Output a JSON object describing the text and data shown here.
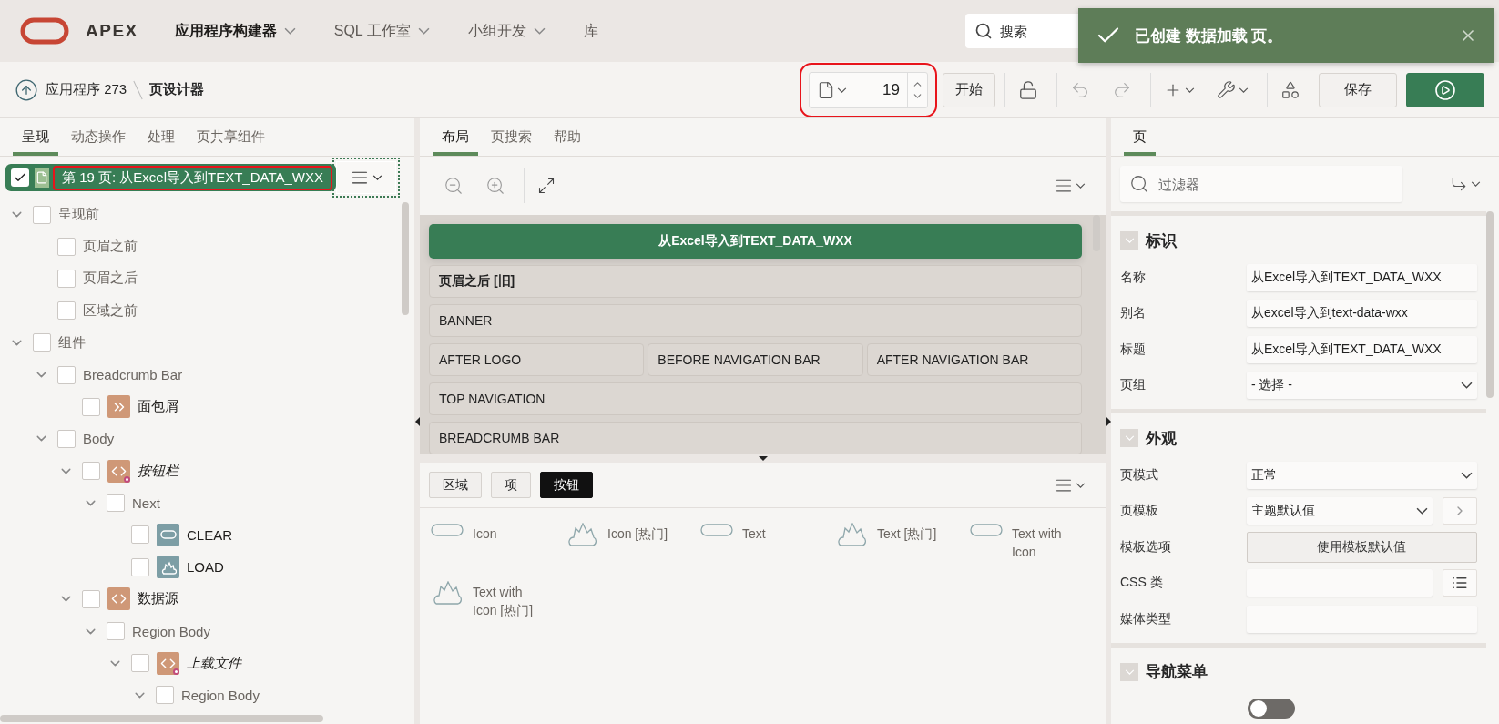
{
  "header": {
    "logo": "APEX",
    "nav": [
      {
        "label": "应用程序构建器",
        "selected": true,
        "has_menu": true
      },
      {
        "label": "SQL 工作室",
        "selected": false,
        "has_menu": true
      },
      {
        "label": "小组开发",
        "selected": false,
        "has_menu": true
      },
      {
        "label": "库",
        "selected": false,
        "has_menu": false
      }
    ],
    "search": {
      "placeholder": "搜索"
    },
    "toast": {
      "message": "已创建 数据加载 页。"
    }
  },
  "breadcrumb": {
    "parent": "应用程序 273",
    "current": "页设计器"
  },
  "toolbar": {
    "page_number": "19",
    "start_button": "开始",
    "save_button": "保存"
  },
  "left": {
    "tabs": [
      {
        "label": "呈现",
        "selected": true
      },
      {
        "label": "动态操作",
        "selected": false
      },
      {
        "label": "处理",
        "selected": false
      },
      {
        "label": "页共享组件",
        "selected": false
      }
    ],
    "tree": {
      "label": "第 19 页: 从Excel导入到TEXT_DATA_WXX",
      "checked": true,
      "children": [
        {
          "label": "呈现前",
          "kind": "group",
          "checked": false,
          "expanded": true,
          "children": [
            {
              "label": "页眉之前",
              "kind": "group",
              "checked": false
            },
            {
              "label": "页眉之后",
              "kind": "group",
              "checked": false
            },
            {
              "label": "区域之前",
              "kind": "group",
              "checked": false
            }
          ]
        },
        {
          "label": "组件",
          "kind": "group",
          "checked": false,
          "expanded": true,
          "children": [
            {
              "label": "Breadcrumb Bar",
              "kind": "group",
              "checked": false,
              "expanded": true,
              "children": [
                {
                  "label": "面包屑",
                  "kind": "breadcrumb",
                  "checked": false
                }
              ]
            },
            {
              "label": "Body",
              "kind": "group",
              "checked": false,
              "expanded": true,
              "children": [
                {
                  "label": "按钮栏",
                  "kind": "region",
                  "conditional": true,
                  "checked": false,
                  "expanded": true,
                  "children": [
                    {
                      "label": "Next",
                      "kind": "group",
                      "checked": false,
                      "expanded": true,
                      "children": [
                        {
                          "label": "CLEAR",
                          "kind": "button",
                          "checked": false
                        },
                        {
                          "label": "LOAD",
                          "kind": "hot-button",
                          "checked": false
                        }
                      ]
                    }
                  ]
                },
                {
                  "label": "数据源",
                  "kind": "region",
                  "conditional": false,
                  "checked": false,
                  "expanded": true,
                  "children": [
                    {
                      "label": "Region Body",
                      "kind": "group",
                      "checked": false,
                      "expanded": true,
                      "children": [
                        {
                          "label": "上载文件",
                          "kind": "region",
                          "conditional": true,
                          "checked": false,
                          "expanded": true,
                          "children": [
                            {
                              "label": "Region Body",
                              "kind": "group",
                              "checked": false,
                              "expanded": true
                            }
                          ]
                        }
                      ]
                    }
                  ]
                }
              ]
            }
          ]
        }
      ]
    }
  },
  "middle": {
    "tabs": [
      {
        "label": "布局",
        "selected": true
      },
      {
        "label": "页搜索",
        "selected": false
      },
      {
        "label": "帮助",
        "selected": false
      }
    ],
    "page_title": "从Excel导入到TEXT_DATA_WXX",
    "slot_rows": [
      [
        {
          "label": "页眉之后 [旧]",
          "kind": "legacy"
        }
      ],
      [
        {
          "label": "BANNER",
          "kind": "position"
        }
      ],
      [
        {
          "label": "AFTER LOGO",
          "kind": "position"
        },
        {
          "label": "BEFORE NAVIGATION BAR",
          "kind": "position"
        },
        {
          "label": "AFTER NAVIGATION BAR",
          "kind": "position"
        }
      ],
      [
        {
          "label": "TOP NAVIGATION",
          "kind": "position"
        }
      ],
      [
        {
          "label": "BREADCRUMB BAR",
          "kind": "position"
        }
      ]
    ],
    "gallery_tabs": [
      {
        "label": "区域",
        "selected": false
      },
      {
        "label": "项",
        "selected": false
      },
      {
        "label": "按钮",
        "selected": true
      }
    ],
    "gallery": [
      {
        "label": "Icon",
        "kind": "pill"
      },
      {
        "label": "Icon [热门]",
        "kind": "hot"
      },
      {
        "label": "Text",
        "kind": "pill"
      },
      {
        "label": "Text [热门]",
        "kind": "hot"
      },
      {
        "label": "Text with Icon",
        "kind": "pill"
      },
      {
        "label": "Text with Icon [热门]",
        "kind": "hot"
      }
    ]
  },
  "right": {
    "tabs": [
      {
        "label": "页",
        "selected": true
      }
    ],
    "filter": {
      "placeholder": "过滤器"
    },
    "sections": [
      {
        "title": "标识",
        "expanded": true,
        "fields": [
          {
            "label": "名称",
            "kind": "text",
            "value": "从Excel导入到TEXT_DATA_WXX"
          },
          {
            "label": "别名",
            "kind": "text",
            "value": "从excel导入到text-data-wxx"
          },
          {
            "label": "标题",
            "kind": "text",
            "value": "从Excel导入到TEXT_DATA_WXX"
          },
          {
            "label": "页组",
            "kind": "select",
            "value": "- 选择 -"
          }
        ]
      },
      {
        "title": "外观",
        "expanded": true,
        "fields": [
          {
            "label": "页模式",
            "kind": "select",
            "value": "正常"
          },
          {
            "label": "页模板",
            "kind": "select-link",
            "value": "主题默认值"
          },
          {
            "label": "模板选项",
            "kind": "button",
            "value": "使用模板默认值"
          },
          {
            "label": "CSS 类",
            "kind": "picker"
          },
          {
            "label": "媒体类型",
            "kind": "text"
          }
        ]
      },
      {
        "title": "导航菜单",
        "expanded": true,
        "fields": [
          {
            "kind": "switch",
            "on": false
          }
        ]
      }
    ]
  }
}
